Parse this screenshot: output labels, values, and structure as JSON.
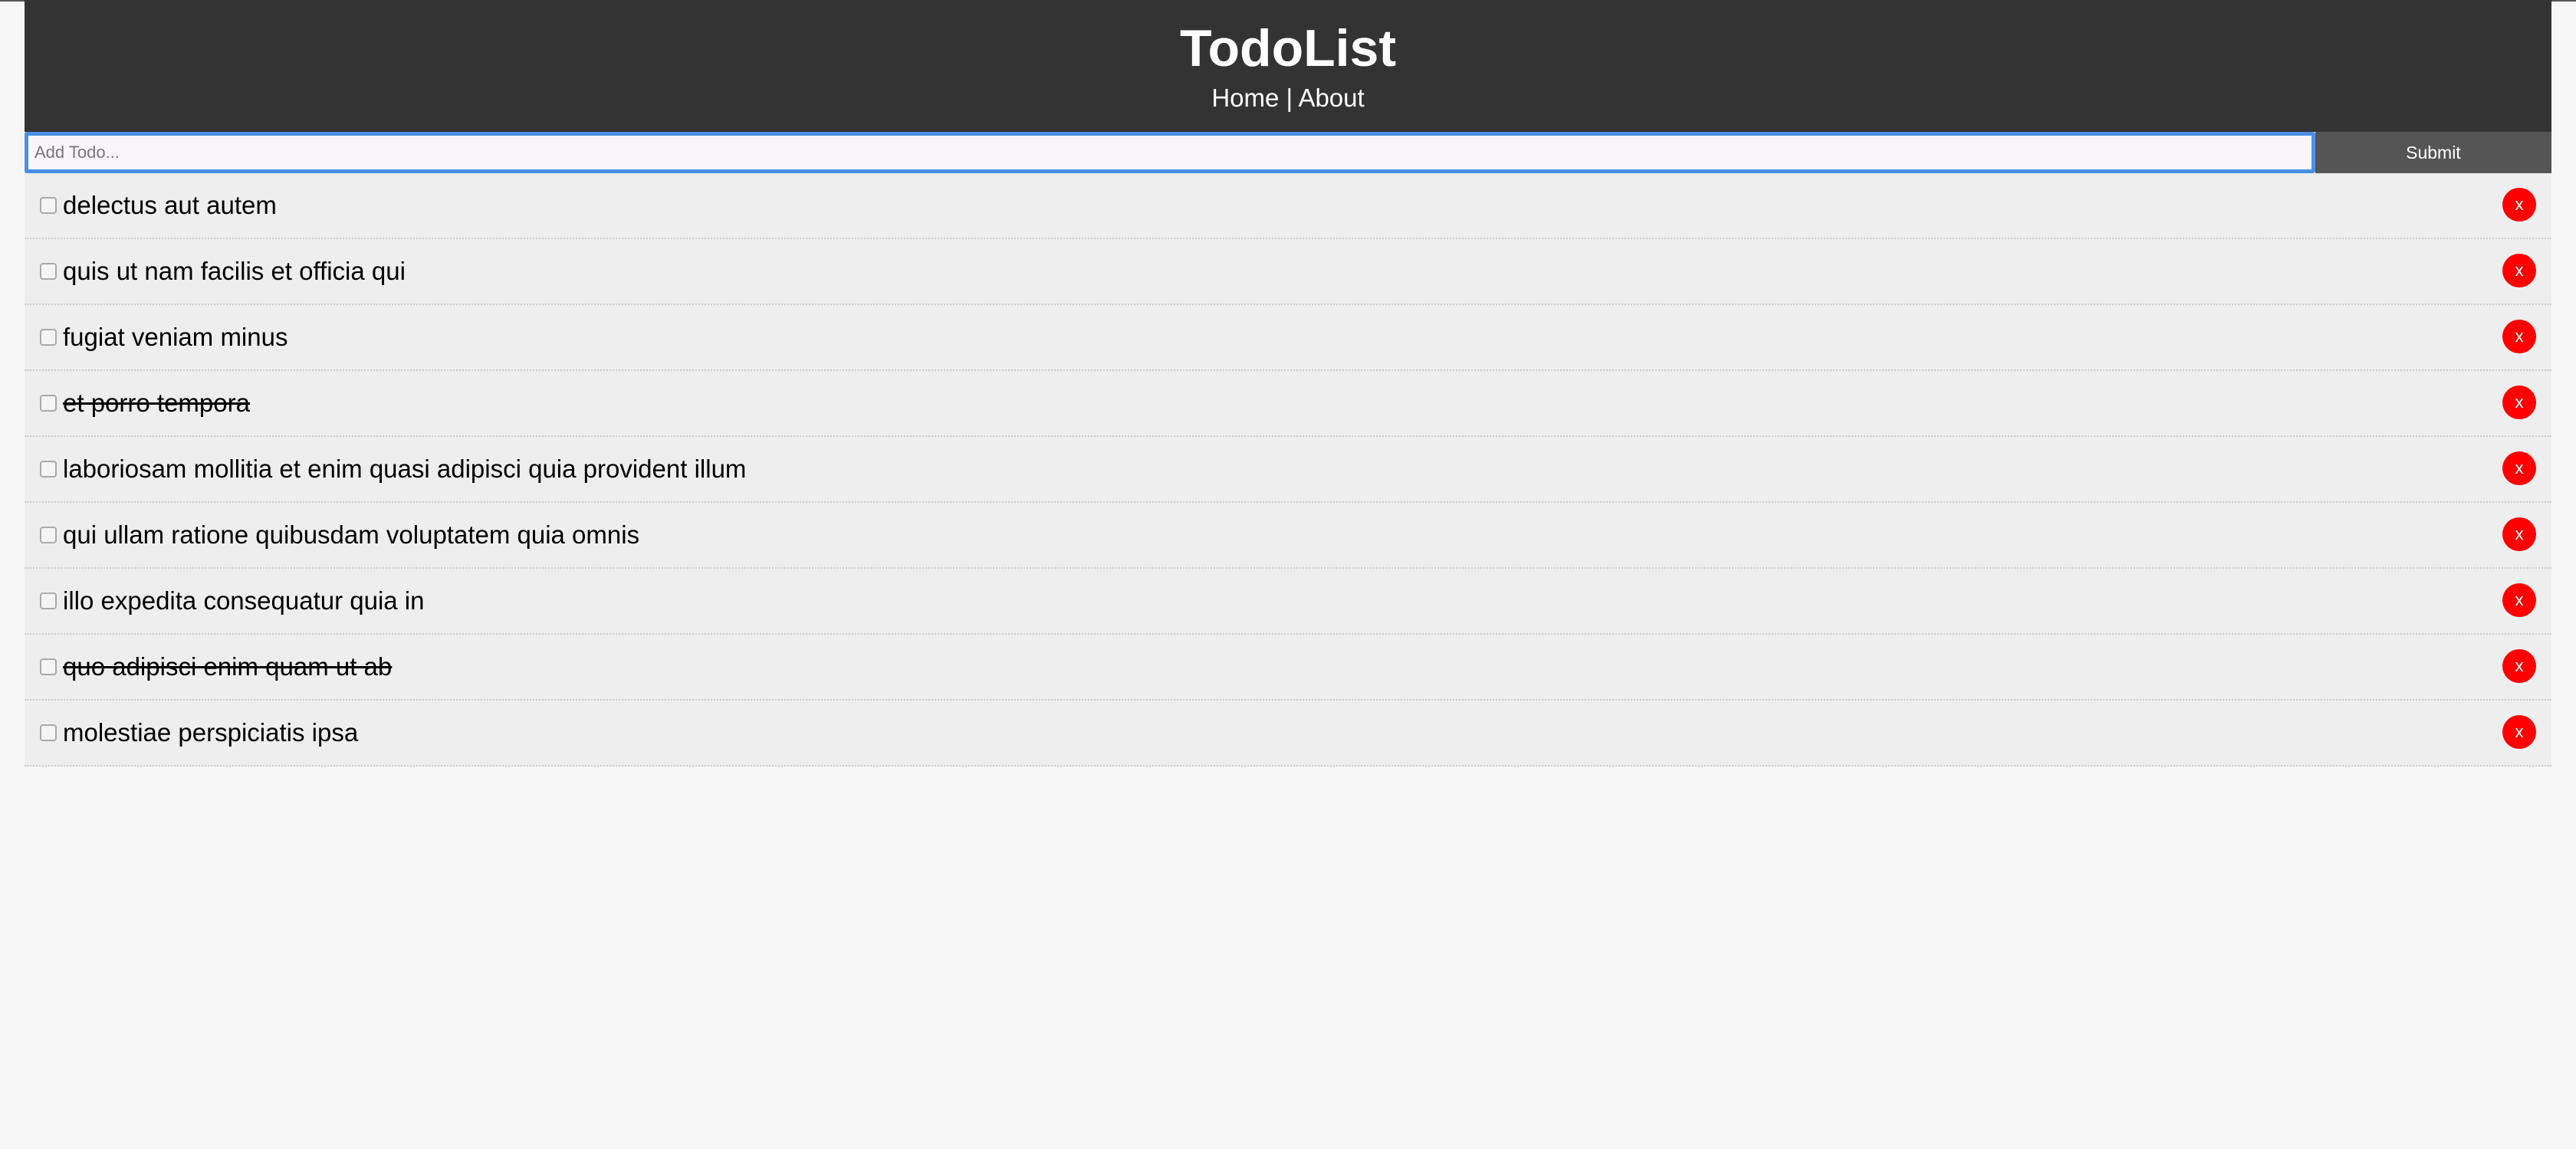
{
  "header": {
    "title": "TodoList",
    "nav": {
      "home": "Home",
      "separator": " | ",
      "about": "About"
    }
  },
  "form": {
    "input_value": "",
    "input_placeholder": "Add Todo...",
    "submit_label": "Submit"
  },
  "todos": [
    {
      "title": "delectus aut autem",
      "completed": false,
      "delete_label": "x"
    },
    {
      "title": "quis ut nam facilis et officia qui",
      "completed": false,
      "delete_label": "x"
    },
    {
      "title": "fugiat veniam minus",
      "completed": false,
      "delete_label": "x"
    },
    {
      "title": "et porro tempora",
      "completed": true,
      "delete_label": "x"
    },
    {
      "title": "laboriosam mollitia et enim quasi adipisci quia provident illum",
      "completed": false,
      "delete_label": "x"
    },
    {
      "title": "qui ullam ratione quibusdam voluptatem quia omnis",
      "completed": false,
      "delete_label": "x"
    },
    {
      "title": "illo expedita consequatur quia in",
      "completed": false,
      "delete_label": "x"
    },
    {
      "title": "quo adipisci enim quam ut ab",
      "completed": true,
      "delete_label": "x"
    },
    {
      "title": "molestiae perspiciatis ipsa",
      "completed": false,
      "delete_label": "x"
    }
  ],
  "colors": {
    "header_bg": "#333333",
    "submit_bg": "#555555",
    "delete_bg": "#ff0000",
    "item_bg": "#eeeeee",
    "input_focus": "#4a90e2"
  }
}
